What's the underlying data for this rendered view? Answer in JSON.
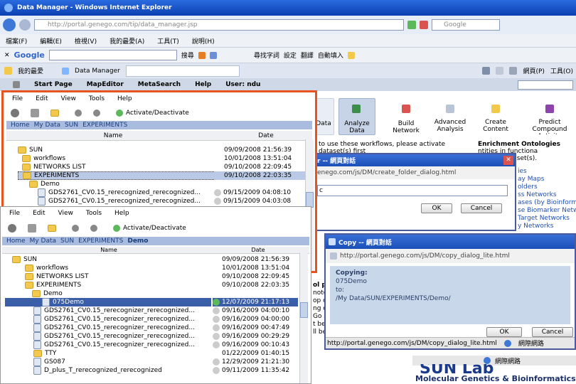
{
  "browser": {
    "title": "Data Manager - Windows Internet Explorer",
    "address": "http://portal.genego.com/tip/data_manager.jsp",
    "search_box": "Google",
    "menu": [
      "檔案(F)",
      "編輯(E)",
      "檢視(V)",
      "我的最愛(A)",
      "工具(T)",
      "說明(H)"
    ],
    "google_bar": {
      "logo": "Google",
      "search": "搜尋",
      "words": "尋找字詞",
      "settings": "設定",
      "translate": "翻譯",
      "autofill": "自動填入"
    },
    "favorites": "我的最愛",
    "tab": "Data Manager",
    "toolbar_right": "網頁(P)",
    "toolbar_tools": "工具(O)",
    "nav": [
      "Start Page",
      "MapEditor",
      "MetaSearch",
      "Help",
      "User: ndu"
    ]
  },
  "apps": {
    "data": "Data",
    "analyze": "Analyze Data",
    "build": "Build Network",
    "advanced": "Advanced Analysis",
    "create": "Create Content",
    "predict": "Predict Compound Activity (MetaDrug)"
  },
  "middle": {
    "workflows_text": "to use these workflows, please activate",
    "dataset": "dataset(s) first",
    "enrichment_title": "Enrichment Ontologies",
    "enrich_lines": [
      "ntities in functiona",
      "tivated dataset(s)."
    ],
    "links": [
      "ies",
      "ay Maps",
      "olders",
      "ss Networks",
      "ases (by Bioinforma",
      "se Biomarker Netw",
      "Target Networks",
      "y Networks"
    ],
    "left_letters": [
      "ol pa",
      "note",
      "op ca",
      "ng ca",
      "Go se",
      "t be",
      "ll be"
    ]
  },
  "create_dialog": {
    "title": "r -- 網頁對話",
    "url": "enego.com/js/DM/create_folder_dialog.html",
    "value": "c",
    "ok": "OK",
    "cancel": "Cancel"
  },
  "copy_dialog": {
    "title": "Copy -- 網頁對話",
    "url": "http://portal.genego.com/js/DM/copy_dialog_lite.html",
    "copying_label": "Copying:",
    "item": "075Demo",
    "to_label": "to:",
    "path": "/My Data/SUN/EXPERIMENTS/Demo/",
    "ok": "OK",
    "cancel": "Cancel",
    "status_url": "http://portal.genego.com/js/DM/copy_dialog_lite.html",
    "status_zone": "網際網路"
  },
  "footer": {
    "zone": "網際網路",
    "brand": "SUN Lab",
    "subtitle": "Molecular Genetics & Bioinformatics"
  },
  "panel1": {
    "menu": [
      "File",
      "Edit",
      "View",
      "Tools",
      "Help"
    ],
    "activate": "Activate/Deactivate",
    "crumbs": [
      "Home",
      "My Data",
      "SUN",
      "EXPERIMENTS"
    ],
    "col_name": "Name",
    "col_date": "Date",
    "rows": [
      {
        "name": "SUN",
        "date": "09/09/2008 21:56:39"
      },
      {
        "name": "workflows",
        "date": "10/01/2008 13:51:04"
      },
      {
        "name": "NETWORKS LIST",
        "date": "09/10/2008 22:09:45"
      },
      {
        "name": "EXPERIMENTS",
        "date": "09/10/2008 22:03:35"
      },
      {
        "name": "Demo",
        "date": ""
      },
      {
        "name": "GDS2761_CV0.15_rerecognized_rerecognized...",
        "date": "09/15/2009 04:08:10"
      },
      {
        "name": "GDS2761_CV0.15_rerecognized_rerecognized...",
        "date": "09/15/2009 04:03:08"
      }
    ]
  },
  "panel2": {
    "menu": [
      "File",
      "Edit",
      "View",
      "Tools",
      "Help"
    ],
    "activate": "Activate/Deactivate",
    "crumbs": [
      "Home",
      "My Data",
      "SUN",
      "EXPERIMENTS",
      "Demo"
    ],
    "col_name": "Name",
    "col_date": "Date",
    "rows": [
      {
        "name": "SUN",
        "date": "09/09/2008 21:56:39"
      },
      {
        "name": "workflows",
        "date": "10/01/2008 13:51:04"
      },
      {
        "name": "NETWORKS LIST",
        "date": "09/10/2008 22:09:45"
      },
      {
        "name": "EXPERIMENTS",
        "date": "09/10/2008 22:03:35"
      },
      {
        "name": "Demo",
        "date": ""
      },
      {
        "name": "075Demo",
        "date": "12/07/2009 21:17:13"
      },
      {
        "name": "GDS2761_CV0.15_rerecognizer_rerecognized...",
        "date": "09/16/2009 04:00:10"
      },
      {
        "name": "GDS2761_CV0.15_rerecognizer_rerecognized...",
        "date": "09/16/2009 04:00:00"
      },
      {
        "name": "GDS2761_CV0.15_rerecognizer_rerecognized...",
        "date": "09/16/2009 00:47:49"
      },
      {
        "name": "GDS2761_CV0.15_rerecognizer_rerecognized...",
        "date": "09/16/2009 00:29:29"
      },
      {
        "name": "GDS2761_CV0.15_rerecognizer_rerecognized...",
        "date": "09/16/2009 00:10:43"
      },
      {
        "name": "TTY",
        "date": "01/22/2009 01:40:15"
      },
      {
        "name": "GS087",
        "date": "12/29/2009 21:21:30"
      },
      {
        "name": "D_plus_T_rerecognized_rerecognized",
        "date": "09/11/2009 11:35:42"
      }
    ]
  },
  "colors": {
    "highlight": "#e8541f",
    "ie_title": "#0a246a",
    "crumb": "#a9bcdf",
    "selection": "#3a5fa8"
  }
}
